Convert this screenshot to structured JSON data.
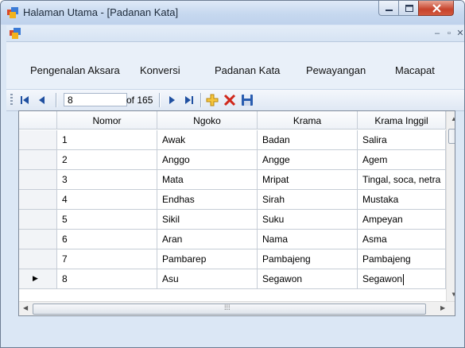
{
  "window": {
    "title": "Halaman Utama - [Padanan Kata]"
  },
  "menu": [
    "Pengenalan Aksara",
    "Konversi",
    "Padanan Kata",
    "Pewayangan",
    "Macapat"
  ],
  "navigator": {
    "position": "8",
    "total_label": "of 165"
  },
  "grid": {
    "columns": [
      "Nomor",
      "Ngoko",
      "Krama",
      "Krama Inggil"
    ],
    "rows": [
      [
        "1",
        "Awak",
        "Badan",
        "Salira"
      ],
      [
        "2",
        "Anggo",
        "Angge",
        "Agem"
      ],
      [
        "3",
        "Mata",
        "Mripat",
        "Tingal, soca, netra"
      ],
      [
        "4",
        "Endhas",
        "Sirah",
        "Mustaka"
      ],
      [
        "5",
        "Sikil",
        "Suku",
        "Ampeyan"
      ],
      [
        "6",
        "Aran",
        "Nama",
        "Asma"
      ],
      [
        "7",
        "Pambarep",
        "Pambajeng",
        "Pambajeng"
      ],
      [
        "8",
        "Asu",
        "Segawon",
        "Segawon"
      ]
    ],
    "current_row_index": 7
  },
  "icons": {
    "move_first": "first-record-icon",
    "move_prev": "previous-record-icon",
    "move_next": "next-record-icon",
    "move_last": "last-record-icon",
    "add": "add-record-icon",
    "delete": "delete-record-icon",
    "save": "save-icon"
  }
}
